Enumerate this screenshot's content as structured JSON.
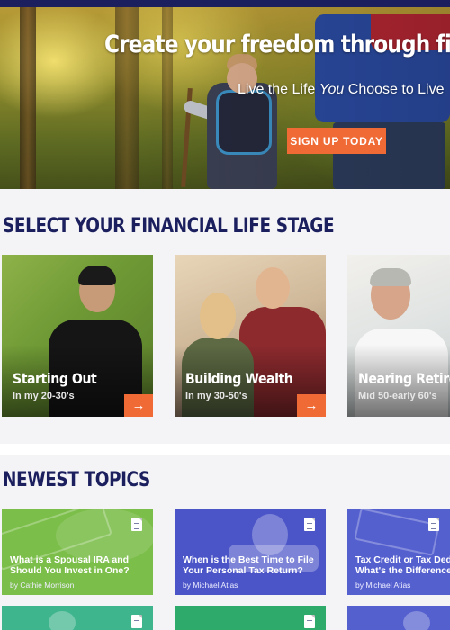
{
  "hero": {
    "title": "Create your freedom through financial",
    "subtitle_before": "Live the Life ",
    "subtitle_emphasis": "You",
    "subtitle_after": " Choose to Live",
    "cta_label": "SIGN UP TODAY"
  },
  "life_stage": {
    "heading": "SELECT YOUR FINANCIAL LIFE STAGE",
    "cards": [
      {
        "title": "Starting Out",
        "subtitle": "In my 20-30's",
        "arrow": "→"
      },
      {
        "title": "Building Wealth",
        "subtitle": "In my 30-50's",
        "arrow": "→"
      },
      {
        "title": "Nearing Retirement",
        "subtitle": "Mid 50-early 60's",
        "arrow": "→"
      }
    ]
  },
  "topics": {
    "heading": "NEWEST TOPICS",
    "cards": [
      {
        "title": "What is a Spousal IRA and Should You Invest in One?",
        "author": "by Cathie Morrison",
        "color": "#7cbe4a",
        "icon": "document-icon"
      },
      {
        "title": "When is the Best Time to File Your Personal Tax Return?",
        "author": "by Michael Atias",
        "color": "#4b55c8",
        "icon": "document-icon"
      },
      {
        "title": "Tax Credit or Tax Deduction: What's the Difference?",
        "author": "by Michael Atias",
        "color": "#5560cf",
        "icon": "document-icon"
      }
    ]
  },
  "colors": {
    "navy": "#1b1f5e",
    "accent_orange": "#f06a35",
    "teal": "#3fb58e",
    "green": "#2eaa6a"
  }
}
